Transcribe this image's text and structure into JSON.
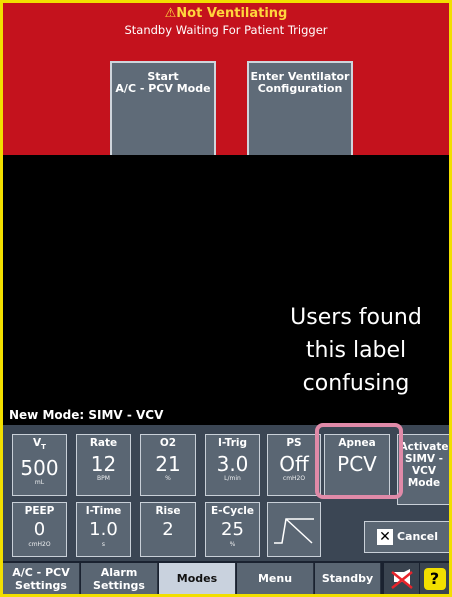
{
  "status": {
    "alert": "⚠Not Ventilating",
    "message": "Standby Waiting For Patient Trigger"
  },
  "top_buttons": [
    {
      "line1": "Start",
      "line2": "A/C - PCV Mode"
    },
    {
      "line1": "Enter Ventilator",
      "line2": "Configuration"
    }
  ],
  "annotation": {
    "line1": "Users found",
    "line2": "this label",
    "line3": "confusing"
  },
  "new_mode": "New Mode: SIMV - VCV",
  "settings_row1": [
    {
      "label": "V",
      "label_sub": "T",
      "value": "500",
      "unit": "mL"
    },
    {
      "label": "Rate",
      "value": "12",
      "unit": "BPM"
    },
    {
      "label": "O2",
      "value": "21",
      "unit": "%"
    },
    {
      "label": "I-Trig",
      "value": "3.0",
      "unit": "L/min"
    },
    {
      "label": "PS",
      "value": "Off",
      "unit": "cmH2O"
    },
    {
      "label": "Apnea",
      "value": "PCV",
      "unit": ""
    }
  ],
  "settings_row2": [
    {
      "label": "PEEP",
      "value": "0",
      "unit": "cmH2O"
    },
    {
      "label": "I-Time",
      "value": "1.0",
      "unit": "s"
    },
    {
      "label": "Rise",
      "value": "2",
      "unit": ""
    },
    {
      "label": "E-Cycle",
      "value": "25",
      "unit": "%"
    }
  ],
  "activate": {
    "line1": "Activate",
    "line2": "SIMV -",
    "line3": "VCV",
    "line4": "Mode"
  },
  "cancel_label": "Cancel",
  "tabs": [
    {
      "line1": "A/C - PCV",
      "line2": "Settings"
    },
    {
      "line1": "Alarm",
      "line2": "Settings"
    },
    {
      "line1": "Modes",
      "line2": ""
    },
    {
      "line1": "Menu",
      "line2": ""
    },
    {
      "line1": "Standby",
      "line2": ""
    }
  ],
  "active_tab": "Modes",
  "help_icon_glyph": "?",
  "colors": {
    "alarm_red": "#c4121d",
    "border_yellow": "#f2df00",
    "highlight_pink": "#e08aa8",
    "panel": "#3b4654",
    "button": "#5a6673"
  }
}
